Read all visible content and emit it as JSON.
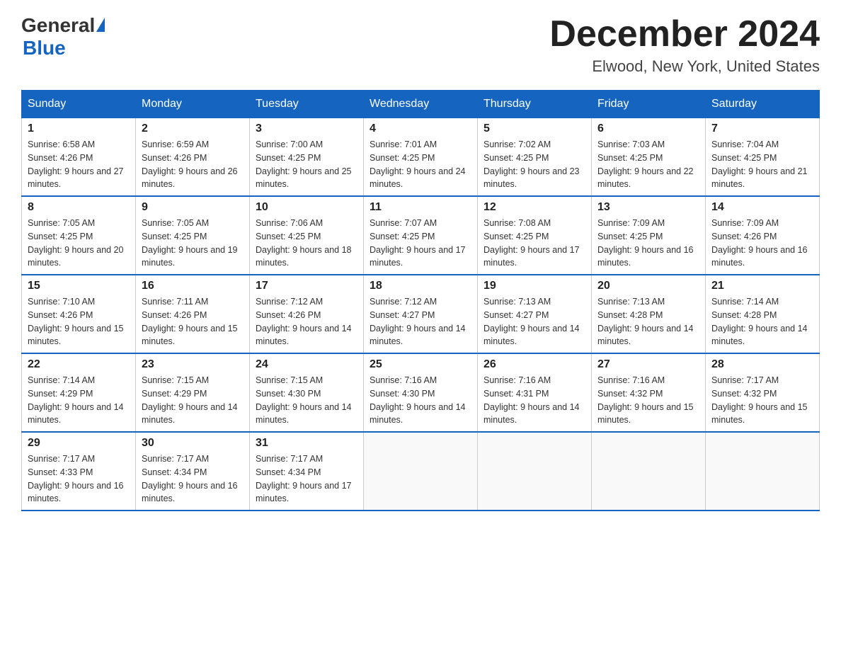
{
  "header": {
    "logo_general": "General",
    "logo_blue": "Blue",
    "month_title": "December 2024",
    "location": "Elwood, New York, United States"
  },
  "days_of_week": [
    "Sunday",
    "Monday",
    "Tuesday",
    "Wednesday",
    "Thursday",
    "Friday",
    "Saturday"
  ],
  "weeks": [
    [
      {
        "day": "1",
        "sunrise": "Sunrise: 6:58 AM",
        "sunset": "Sunset: 4:26 PM",
        "daylight": "Daylight: 9 hours and 27 minutes."
      },
      {
        "day": "2",
        "sunrise": "Sunrise: 6:59 AM",
        "sunset": "Sunset: 4:26 PM",
        "daylight": "Daylight: 9 hours and 26 minutes."
      },
      {
        "day": "3",
        "sunrise": "Sunrise: 7:00 AM",
        "sunset": "Sunset: 4:25 PM",
        "daylight": "Daylight: 9 hours and 25 minutes."
      },
      {
        "day": "4",
        "sunrise": "Sunrise: 7:01 AM",
        "sunset": "Sunset: 4:25 PM",
        "daylight": "Daylight: 9 hours and 24 minutes."
      },
      {
        "day": "5",
        "sunrise": "Sunrise: 7:02 AM",
        "sunset": "Sunset: 4:25 PM",
        "daylight": "Daylight: 9 hours and 23 minutes."
      },
      {
        "day": "6",
        "sunrise": "Sunrise: 7:03 AM",
        "sunset": "Sunset: 4:25 PM",
        "daylight": "Daylight: 9 hours and 22 minutes."
      },
      {
        "day": "7",
        "sunrise": "Sunrise: 7:04 AM",
        "sunset": "Sunset: 4:25 PM",
        "daylight": "Daylight: 9 hours and 21 minutes."
      }
    ],
    [
      {
        "day": "8",
        "sunrise": "Sunrise: 7:05 AM",
        "sunset": "Sunset: 4:25 PM",
        "daylight": "Daylight: 9 hours and 20 minutes."
      },
      {
        "day": "9",
        "sunrise": "Sunrise: 7:05 AM",
        "sunset": "Sunset: 4:25 PM",
        "daylight": "Daylight: 9 hours and 19 minutes."
      },
      {
        "day": "10",
        "sunrise": "Sunrise: 7:06 AM",
        "sunset": "Sunset: 4:25 PM",
        "daylight": "Daylight: 9 hours and 18 minutes."
      },
      {
        "day": "11",
        "sunrise": "Sunrise: 7:07 AM",
        "sunset": "Sunset: 4:25 PM",
        "daylight": "Daylight: 9 hours and 17 minutes."
      },
      {
        "day": "12",
        "sunrise": "Sunrise: 7:08 AM",
        "sunset": "Sunset: 4:25 PM",
        "daylight": "Daylight: 9 hours and 17 minutes."
      },
      {
        "day": "13",
        "sunrise": "Sunrise: 7:09 AM",
        "sunset": "Sunset: 4:25 PM",
        "daylight": "Daylight: 9 hours and 16 minutes."
      },
      {
        "day": "14",
        "sunrise": "Sunrise: 7:09 AM",
        "sunset": "Sunset: 4:26 PM",
        "daylight": "Daylight: 9 hours and 16 minutes."
      }
    ],
    [
      {
        "day": "15",
        "sunrise": "Sunrise: 7:10 AM",
        "sunset": "Sunset: 4:26 PM",
        "daylight": "Daylight: 9 hours and 15 minutes."
      },
      {
        "day": "16",
        "sunrise": "Sunrise: 7:11 AM",
        "sunset": "Sunset: 4:26 PM",
        "daylight": "Daylight: 9 hours and 15 minutes."
      },
      {
        "day": "17",
        "sunrise": "Sunrise: 7:12 AM",
        "sunset": "Sunset: 4:26 PM",
        "daylight": "Daylight: 9 hours and 14 minutes."
      },
      {
        "day": "18",
        "sunrise": "Sunrise: 7:12 AM",
        "sunset": "Sunset: 4:27 PM",
        "daylight": "Daylight: 9 hours and 14 minutes."
      },
      {
        "day": "19",
        "sunrise": "Sunrise: 7:13 AM",
        "sunset": "Sunset: 4:27 PM",
        "daylight": "Daylight: 9 hours and 14 minutes."
      },
      {
        "day": "20",
        "sunrise": "Sunrise: 7:13 AM",
        "sunset": "Sunset: 4:28 PM",
        "daylight": "Daylight: 9 hours and 14 minutes."
      },
      {
        "day": "21",
        "sunrise": "Sunrise: 7:14 AM",
        "sunset": "Sunset: 4:28 PM",
        "daylight": "Daylight: 9 hours and 14 minutes."
      }
    ],
    [
      {
        "day": "22",
        "sunrise": "Sunrise: 7:14 AM",
        "sunset": "Sunset: 4:29 PM",
        "daylight": "Daylight: 9 hours and 14 minutes."
      },
      {
        "day": "23",
        "sunrise": "Sunrise: 7:15 AM",
        "sunset": "Sunset: 4:29 PM",
        "daylight": "Daylight: 9 hours and 14 minutes."
      },
      {
        "day": "24",
        "sunrise": "Sunrise: 7:15 AM",
        "sunset": "Sunset: 4:30 PM",
        "daylight": "Daylight: 9 hours and 14 minutes."
      },
      {
        "day": "25",
        "sunrise": "Sunrise: 7:16 AM",
        "sunset": "Sunset: 4:30 PM",
        "daylight": "Daylight: 9 hours and 14 minutes."
      },
      {
        "day": "26",
        "sunrise": "Sunrise: 7:16 AM",
        "sunset": "Sunset: 4:31 PM",
        "daylight": "Daylight: 9 hours and 14 minutes."
      },
      {
        "day": "27",
        "sunrise": "Sunrise: 7:16 AM",
        "sunset": "Sunset: 4:32 PM",
        "daylight": "Daylight: 9 hours and 15 minutes."
      },
      {
        "day": "28",
        "sunrise": "Sunrise: 7:17 AM",
        "sunset": "Sunset: 4:32 PM",
        "daylight": "Daylight: 9 hours and 15 minutes."
      }
    ],
    [
      {
        "day": "29",
        "sunrise": "Sunrise: 7:17 AM",
        "sunset": "Sunset: 4:33 PM",
        "daylight": "Daylight: 9 hours and 16 minutes."
      },
      {
        "day": "30",
        "sunrise": "Sunrise: 7:17 AM",
        "sunset": "Sunset: 4:34 PM",
        "daylight": "Daylight: 9 hours and 16 minutes."
      },
      {
        "day": "31",
        "sunrise": "Sunrise: 7:17 AM",
        "sunset": "Sunset: 4:34 PM",
        "daylight": "Daylight: 9 hours and 17 minutes."
      },
      null,
      null,
      null,
      null
    ]
  ]
}
